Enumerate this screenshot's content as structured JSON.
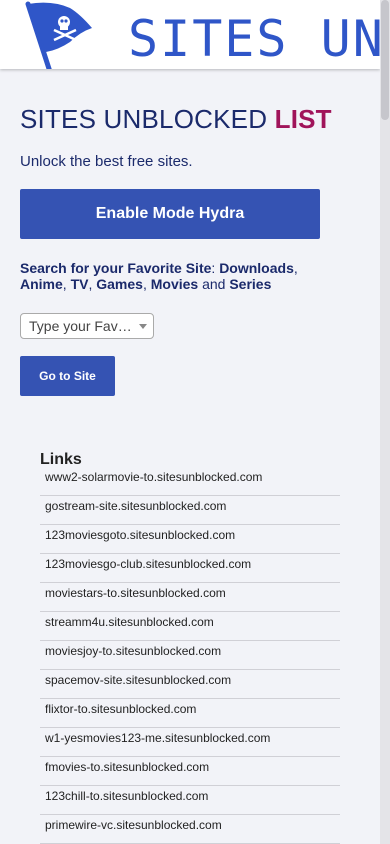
{
  "header": {
    "logo_text": "SITES UNBLOCKED",
    "flag_color": "#2f56c8"
  },
  "title": {
    "main": "SITES UNBLOCKED",
    "accent": "LIST"
  },
  "tagline": "Unlock the best free sites.",
  "hydra_button": "Enable Mode Hydra",
  "search": {
    "lead": "Search for your Favorite Site",
    "colon": ": ",
    "cat1": "Downloads",
    "cat2": "Anime",
    "cat3": "TV",
    "cat4": "Games",
    "cat5": "Movies",
    "sep": ", ",
    "and": " and ",
    "cat6": "Series"
  },
  "select": {
    "value": "Type your Favorite Site"
  },
  "go_button": "Go to Site",
  "links": {
    "heading": "Links",
    "items": [
      "www2-solarmovie-to.sitesunblocked.com",
      "gostream-site.sitesunblocked.com",
      "123moviesgoto.sitesunblocked.com",
      "123moviesgo-club.sitesunblocked.com",
      "moviestars-to.sitesunblocked.com",
      "streamm4u.sitesunblocked.com",
      "moviesjoy-to.sitesunblocked.com",
      "spacemov-site.sitesunblocked.com",
      "flixtor-to.sitesunblocked.com",
      "w1-yesmovies123-me.sitesunblocked.com",
      "fmovies-to.sitesunblocked.com",
      "123chill-to.sitesunblocked.com",
      "primewire-vc.sitesunblocked.com"
    ]
  },
  "colors": {
    "primary": "#3553b3",
    "accent": "#a0145a",
    "text": "#1b2a6b",
    "background": "#f2f3f8"
  }
}
